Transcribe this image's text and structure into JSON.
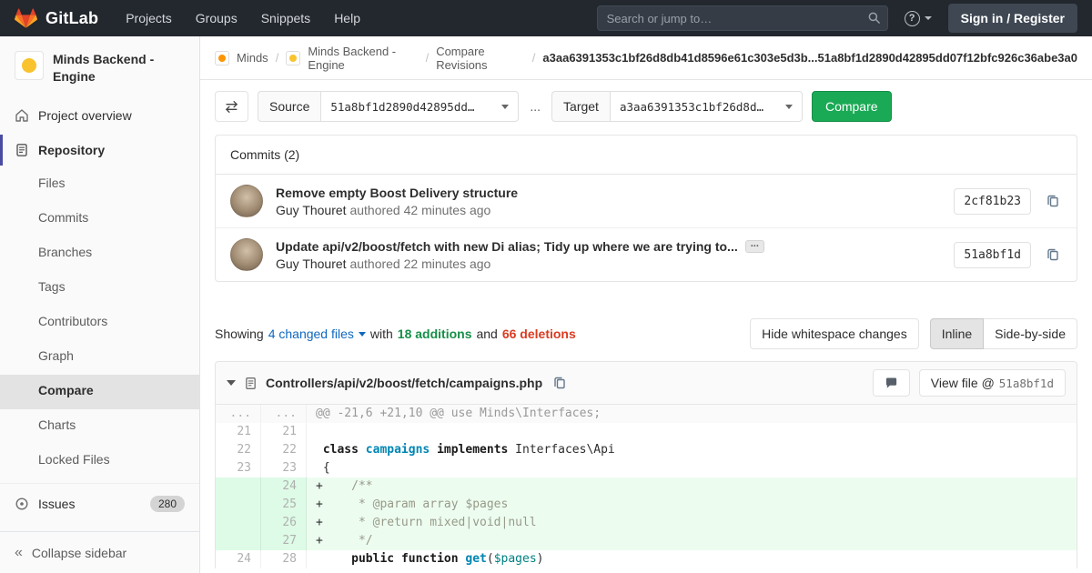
{
  "colors": {
    "brand_orange": "#fc6d26",
    "navbar_bg": "#23272e",
    "accent_green": "#1aaa55",
    "link_blue": "#1068bf",
    "addition_green": "#168f48",
    "deletion_red": "#db3b21",
    "added_line_bg": "#ecfdf0",
    "sidebar_active_indicator": "#4b4ba3"
  },
  "icons": {
    "logo": "gitlab-tanuki",
    "search": "magnifier",
    "help": "question-mark-circle",
    "nav_caret": "chevron-down",
    "home": "house",
    "repository": "document-lines",
    "issues": "circle-dot",
    "collapse": "double-chevron-left",
    "swap": "swap-arrows",
    "dropdown_caret": "chevron-down",
    "copy": "clipboard",
    "expand_commit": "ellipsis",
    "collapse_diff": "triangle-down",
    "file": "document",
    "comment": "speech-bubble"
  },
  "navbar": {
    "brand": "GitLab",
    "menu": [
      "Projects",
      "Groups",
      "Snippets",
      "Help"
    ],
    "search_placeholder": "Search or jump to…",
    "sign_in": "Sign in / Register"
  },
  "sidebar": {
    "project_title": "Minds Backend - Engine",
    "overview": "Project overview",
    "repository": "Repository",
    "repo_items": [
      "Files",
      "Commits",
      "Branches",
      "Tags",
      "Contributors",
      "Graph",
      "Compare",
      "Charts",
      "Locked Files"
    ],
    "active_item": "Compare",
    "issues": {
      "label": "Issues",
      "count": "280"
    },
    "collapse": "Collapse sidebar"
  },
  "breadcrumb": {
    "items": [
      "Minds",
      "Minds Backend - Engine",
      "Compare Revisions"
    ],
    "current": "a3aa6391353c1bf26d8db41d8596e61c303e5d3b...51a8bf1d2890d42895dd07f12bfc926c36abe3a0"
  },
  "compare_form": {
    "source_label": "Source",
    "source_value": "51a8bf1d2890d42895dd…",
    "separator": "...",
    "target_label": "Target",
    "target_value": "a3aa6391353c1bf26d8d…",
    "compare_button": "Compare"
  },
  "commits": {
    "header": "Commits (2)",
    "items": [
      {
        "title": "Remove empty Boost Delivery structure",
        "author": "Guy Thouret",
        "meta": "authored 42 minutes ago",
        "sha": "2cf81b23"
      },
      {
        "title": "Update api/v2/boost/fetch with new Di alias; Tidy up where we are trying to...",
        "author": "Guy Thouret",
        "meta": "authored 22 minutes ago",
        "sha": "51a8bf1d"
      }
    ]
  },
  "diff_summary": {
    "showing": "Showing",
    "files_link": "4 changed files",
    "with": "with",
    "additions": "18 additions",
    "and": "and",
    "deletions": "66 deletions",
    "whitespace_button": "Hide whitespace changes",
    "inline": "Inline",
    "side_by_side": "Side-by-side"
  },
  "diff_file": {
    "path": "Controllers/api/v2/boost/fetch/campaigns.php",
    "view_file": "View file @",
    "view_file_sha": "51a8bf1d",
    "lines": [
      {
        "old": "...",
        "new": "...",
        "type": "hunk",
        "tokens": [
          {
            "t": "@@ -21,6 +21,10 @@ use Minds\\Interfaces;",
            "c": "hunk"
          }
        ]
      },
      {
        "old": "21",
        "new": "21",
        "type": "context",
        "tokens": [
          {
            "t": "",
            "c": "p"
          }
        ]
      },
      {
        "old": "22",
        "new": "22",
        "type": "context",
        "tokens": [
          {
            "t": " ",
            "c": "p"
          },
          {
            "t": "class",
            "c": "k"
          },
          {
            "t": " ",
            "c": "p"
          },
          {
            "t": "campaigns",
            "c": "nc"
          },
          {
            "t": " ",
            "c": "p"
          },
          {
            "t": "implements",
            "c": "k"
          },
          {
            "t": " Interfaces\\Api",
            "c": "p"
          }
        ]
      },
      {
        "old": "23",
        "new": "23",
        "type": "context",
        "tokens": [
          {
            "t": " {",
            "c": "p"
          }
        ]
      },
      {
        "old": "",
        "new": "24",
        "type": "added",
        "tokens": [
          {
            "t": "+    ",
            "c": "p"
          },
          {
            "t": "/**",
            "c": "c"
          }
        ]
      },
      {
        "old": "",
        "new": "25",
        "type": "added",
        "tokens": [
          {
            "t": "+     ",
            "c": "p"
          },
          {
            "t": "* @param array $pages",
            "c": "c"
          }
        ]
      },
      {
        "old": "",
        "new": "26",
        "type": "added",
        "tokens": [
          {
            "t": "+     ",
            "c": "p"
          },
          {
            "t": "* @return mixed|void|null",
            "c": "c"
          }
        ]
      },
      {
        "old": "",
        "new": "27",
        "type": "added",
        "tokens": [
          {
            "t": "+     ",
            "c": "p"
          },
          {
            "t": "*/",
            "c": "c"
          }
        ]
      },
      {
        "old": "24",
        "new": "28",
        "type": "context",
        "tokens": [
          {
            "t": "     ",
            "c": "p"
          },
          {
            "t": "public",
            "c": "k"
          },
          {
            "t": " ",
            "c": "p"
          },
          {
            "t": "function",
            "c": "k"
          },
          {
            "t": " ",
            "c": "p"
          },
          {
            "t": "get",
            "c": "nf"
          },
          {
            "t": "(",
            "c": "p"
          },
          {
            "t": "$pages",
            "c": "nv"
          },
          {
            "t": ")",
            "c": "p"
          }
        ]
      }
    ]
  }
}
